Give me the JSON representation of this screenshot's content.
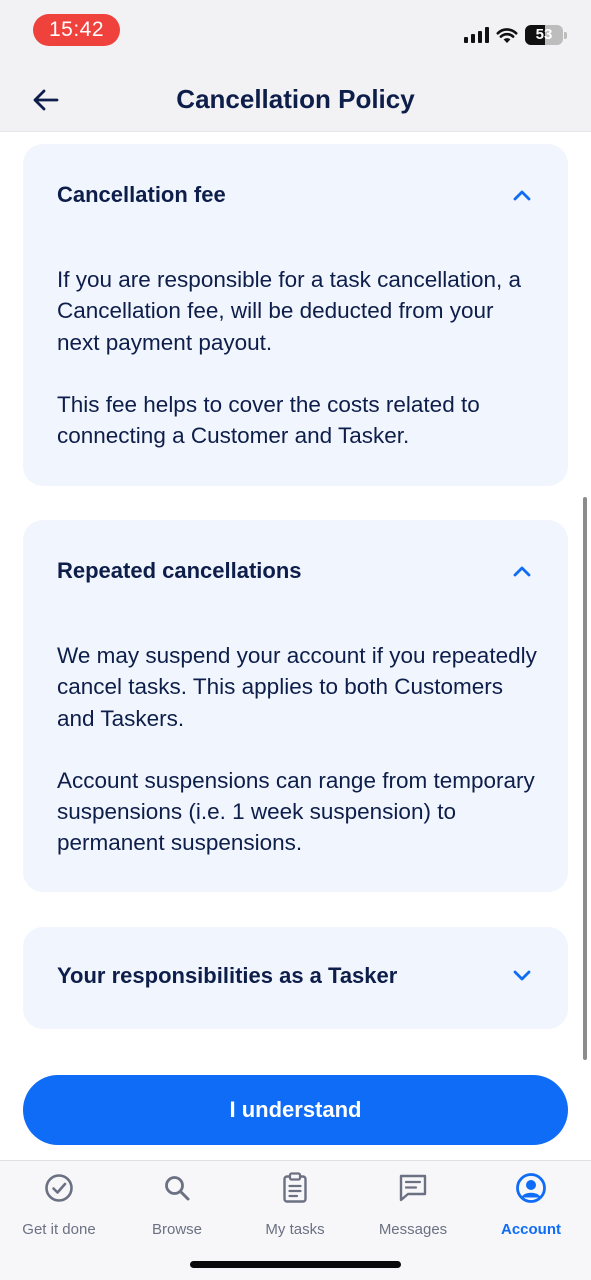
{
  "status_bar": {
    "time": "15:42",
    "battery": "53",
    "icons": [
      "signal-icon",
      "wifi-icon",
      "battery-icon"
    ]
  },
  "header": {
    "title": "Cancellation Policy",
    "back_icon": "arrow-left-icon"
  },
  "sections": [
    {
      "title": "Cancellation fee",
      "expanded": true,
      "paragraphs": [
        "If you are responsible for a task cancellation, a Cancellation fee, will be deducted from your next payment payout.",
        "This fee helps to cover the costs related to connecting a Customer and Tasker."
      ]
    },
    {
      "title": "Repeated cancellations",
      "expanded": true,
      "paragraphs": [
        "We may suspend your account if you repeatedly cancel tasks. This applies to both Customers and Taskers.",
        "Account suspensions can range from temporary suspensions (i.e. 1 week suspension) to permanent suspensions."
      ]
    },
    {
      "title": "Your responsibilities as a Tasker",
      "expanded": false,
      "paragraphs": []
    }
  ],
  "primary_button": {
    "label": "I understand"
  },
  "tabbar": {
    "items": [
      {
        "label": "Get it done",
        "icon": "check-circle-icon",
        "active": false
      },
      {
        "label": "Browse",
        "icon": "search-icon",
        "active": false
      },
      {
        "label": "My tasks",
        "icon": "clipboard-icon",
        "active": false
      },
      {
        "label": "Messages",
        "icon": "chat-icon",
        "active": false
      },
      {
        "label": "Account",
        "icon": "user-circle-icon",
        "active": true
      }
    ]
  },
  "colors": {
    "accent": "#0f6cf6",
    "text": "#0e1e4a",
    "card_bg": "#f1f5fd",
    "status_time_pill": "#f0423d"
  }
}
